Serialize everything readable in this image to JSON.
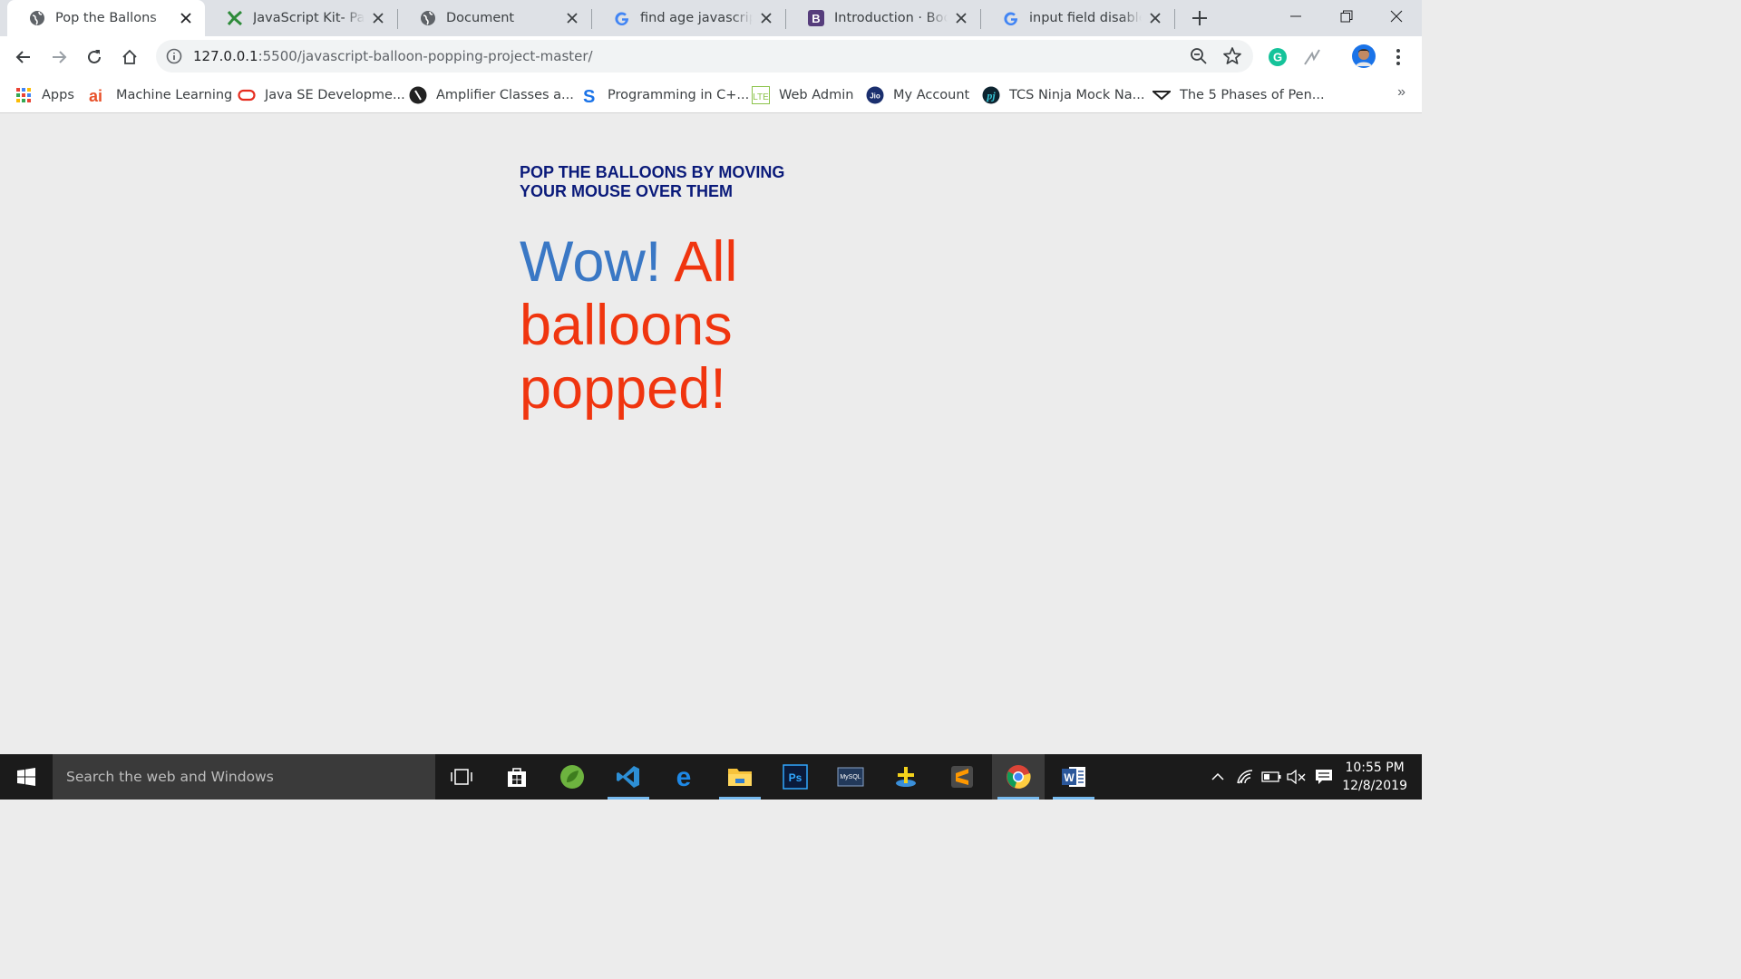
{
  "browser": {
    "tabs": [
      {
        "title": "Pop the Ballons",
        "favicon": "globe-icon",
        "active": true
      },
      {
        "title": "JavaScript Kit- Passw",
        "favicon": "jskit-icon",
        "active": false
      },
      {
        "title": "Document",
        "favicon": "globe-icon",
        "active": false
      },
      {
        "title": "find age javascript - G",
        "favicon": "google-icon",
        "active": false
      },
      {
        "title": "Introduction · Bootstr",
        "favicon": "bootstrap-icon",
        "active": false
      },
      {
        "title": "input field disable aft",
        "favicon": "google-icon",
        "active": false
      }
    ],
    "address": {
      "host": "127.0.0.1",
      "path": ":5500/javascript-balloon-popping-project-master/"
    },
    "bookmarks": [
      {
        "label": "Apps",
        "icon": "apps-grid-icon"
      },
      {
        "label": "Machine Learning",
        "icon": "ai-icon"
      },
      {
        "label": "Java SE Developme...",
        "icon": "oracle-icon"
      },
      {
        "label": "Amplifier Classes a...",
        "icon": "amplifier-icon"
      },
      {
        "label": "Programming in C+...",
        "icon": "s-icon"
      },
      {
        "label": "Web Admin",
        "icon": "lte-icon"
      },
      {
        "label": "My Account",
        "icon": "jio-icon"
      },
      {
        "label": "TCS Ninja Mock Na...",
        "icon": "pj-icon"
      },
      {
        "label": "The 5 Phases of Pen...",
        "icon": "phases-icon"
      }
    ],
    "bookmarks_overflow": "»"
  },
  "page": {
    "instructions": "POP THE BALLOONS BY MOVING YOUR MOUSE OVER THEM",
    "message_wow": "Wow!",
    "message_rest": "All balloons popped!"
  },
  "taskbar": {
    "search_placeholder": "Search the web and Windows",
    "time": "10:55 PM",
    "date": "12/8/2019"
  },
  "colors": {
    "instructions": "#0a1a7a",
    "wow": "#3a78c5",
    "rest": "#f0350f",
    "page_background": "#ececec"
  }
}
